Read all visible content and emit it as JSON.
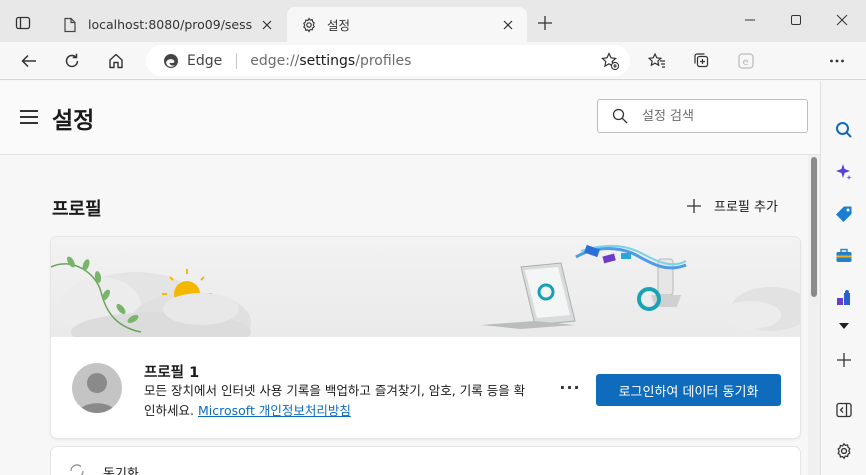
{
  "tabs": [
    {
      "title": "localhost:8080/pro09/sess",
      "active": false
    },
    {
      "title": "설정",
      "active": true
    }
  ],
  "address": {
    "edge_label": "Edge",
    "url_prefix": "edge://",
    "url_bold": "settings",
    "url_suffix": "/profiles"
  },
  "settings": {
    "title": "설정",
    "search_placeholder": "설정 검색"
  },
  "profiles": {
    "section_title": "프로필",
    "add_profile_label": "프로필 추가",
    "profile_name": "프로필 1",
    "description": "모든 장치에서 인터넷 사용 기록을 백업하고 즐겨찾기, 암호, 기록 등을 확인하세요.",
    "privacy_link": "Microsoft 개인정보처리방침",
    "more_label": "···",
    "sync_button_label": "로그인하여 데이터 동기화",
    "next_item_label": "동기화"
  },
  "colors": {
    "accent": "#0f6cbd",
    "tabstrip": "#e8e8e8",
    "page_bg": "#f7f7f7"
  }
}
